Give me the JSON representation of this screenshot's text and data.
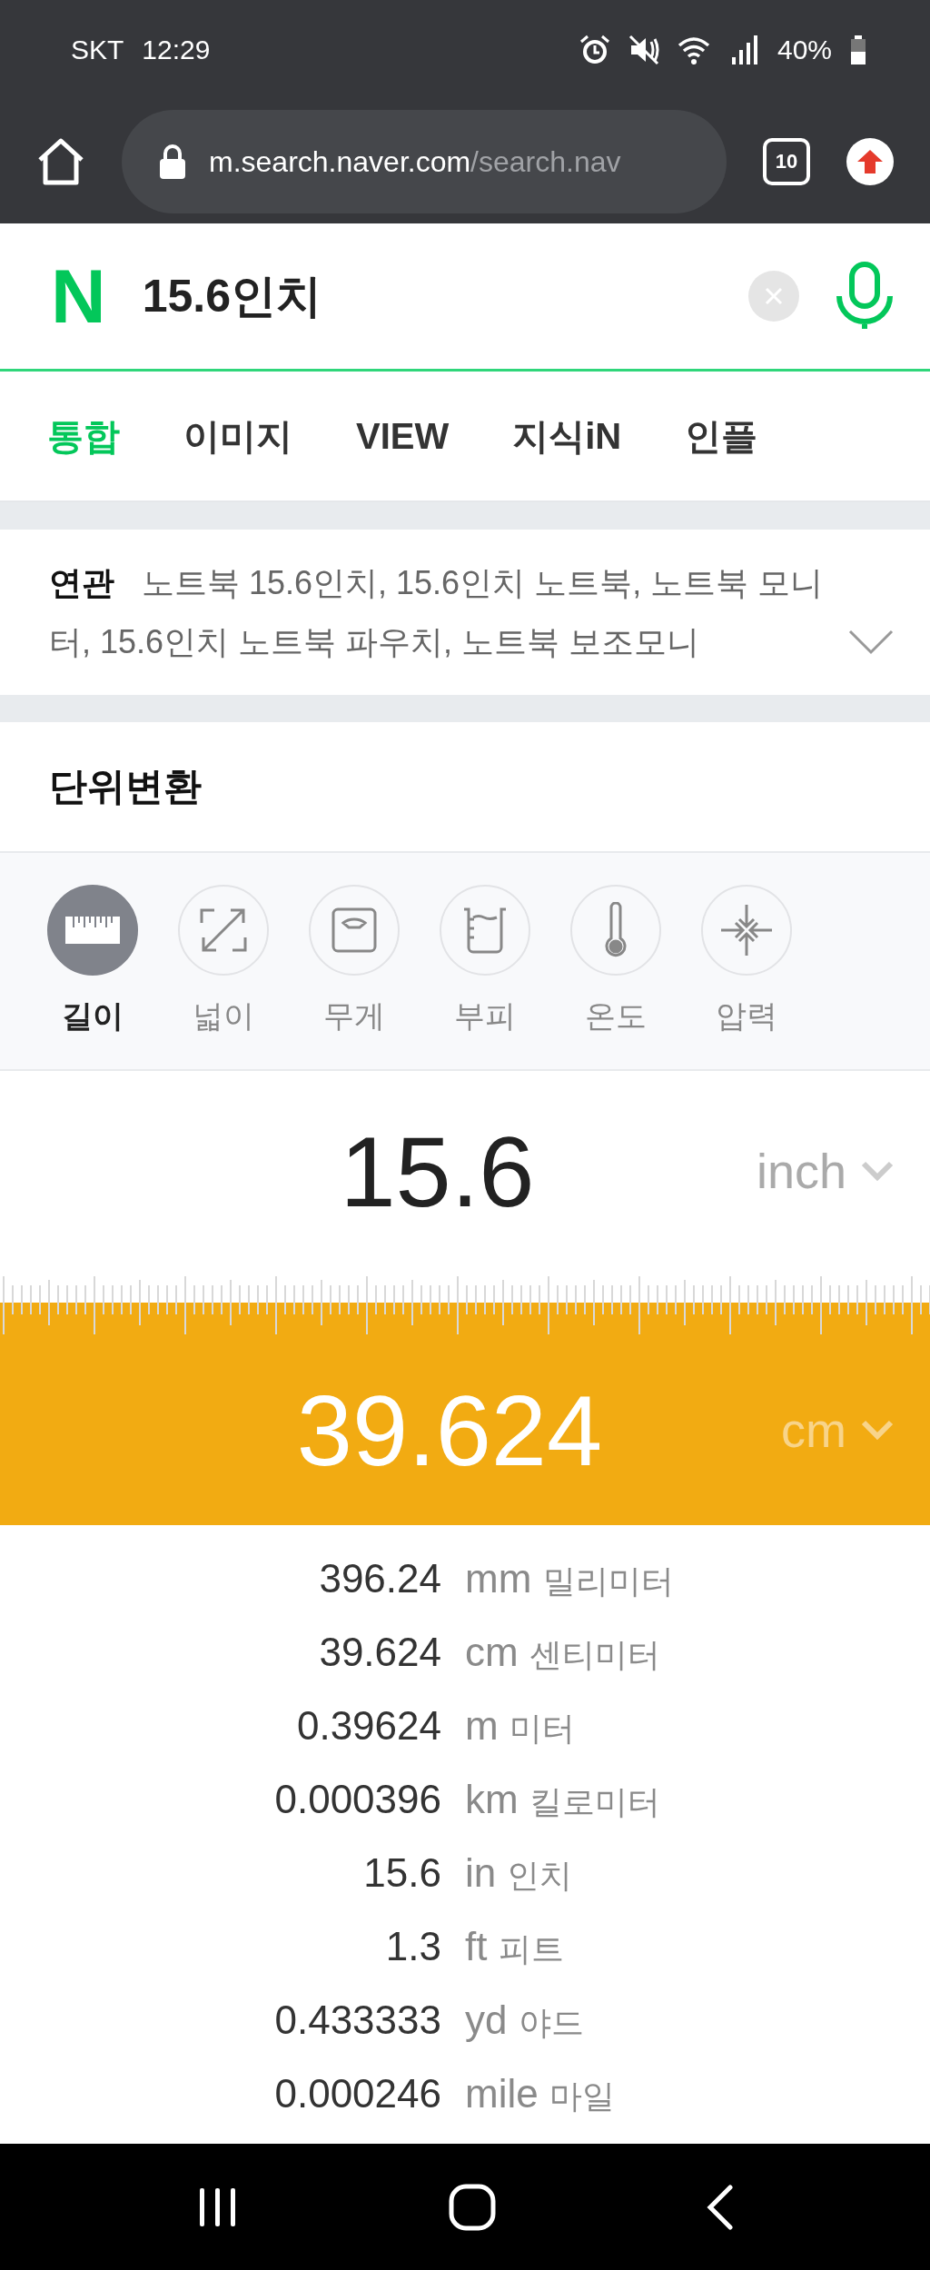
{
  "status_bar": {
    "carrier": "SKT",
    "time": "12:29",
    "battery": "40%"
  },
  "browser": {
    "url_host": "m.search.naver.com",
    "url_path": "/search.nav",
    "tab_count": "10"
  },
  "search": {
    "logo": "N",
    "query": "15.6인치"
  },
  "tabs": [
    {
      "label": "통합",
      "selected": true
    },
    {
      "label": "이미지",
      "selected": false
    },
    {
      "label": "VIEW",
      "selected": false
    },
    {
      "label": "지식iN",
      "selected": false
    },
    {
      "label": "인플",
      "selected": false
    }
  ],
  "related": {
    "label": "연관",
    "text": "노트북 15.6인치, 15.6인치 노트북, 노트북 모니터, 15.6인치 노트북 파우치, 노트북 보조모니"
  },
  "converter": {
    "title": "단위변환",
    "categories": [
      {
        "label": "길이",
        "kind": "ruler",
        "selected": true
      },
      {
        "label": "넓이",
        "kind": "area",
        "selected": false
      },
      {
        "label": "무게",
        "kind": "scale",
        "selected": false
      },
      {
        "label": "부피",
        "kind": "beaker",
        "selected": false
      },
      {
        "label": "온도",
        "kind": "thermometer",
        "selected": false
      },
      {
        "label": "압력",
        "kind": "pressure",
        "selected": false
      }
    ],
    "input": {
      "value": "15.6",
      "unit": "inch"
    },
    "output": {
      "value": "39.624",
      "unit": "cm"
    },
    "results": [
      {
        "value": "396.24",
        "unit": "mm",
        "name": "밀리미터"
      },
      {
        "value": "39.624",
        "unit": "cm",
        "name": "센티미터"
      },
      {
        "value": "0.39624",
        "unit": "m",
        "name": "미터"
      },
      {
        "value": "0.000396",
        "unit": "km",
        "name": "킬로미터"
      },
      {
        "value": "15.6",
        "unit": "in",
        "name": "인치"
      },
      {
        "value": "1.3",
        "unit": "ft",
        "name": "피트"
      },
      {
        "value": "0.433333",
        "unit": "yd",
        "name": "야드"
      },
      {
        "value": "0.000246",
        "unit": "mile",
        "name": "마일"
      }
    ]
  }
}
